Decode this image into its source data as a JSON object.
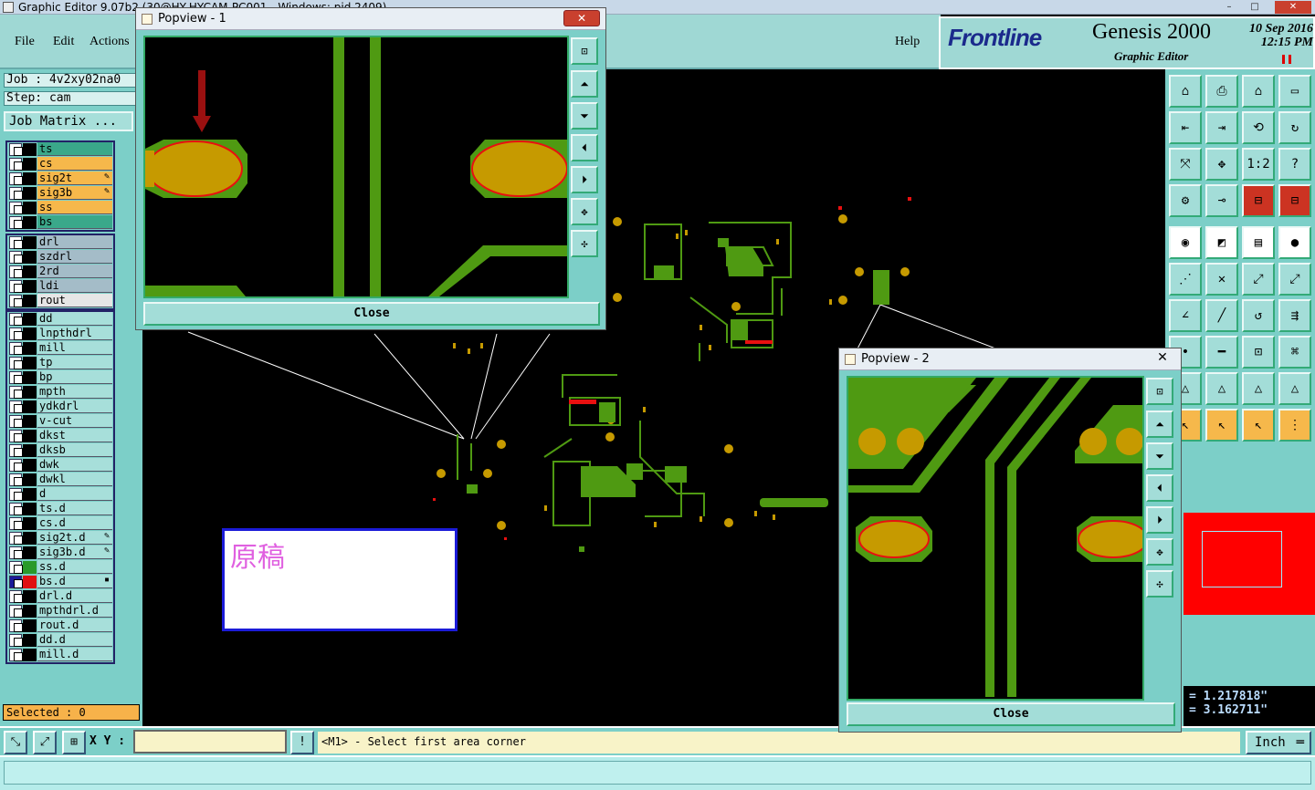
{
  "window": {
    "title": "Graphic Editor 9.07b2 (30@HY-HYCAM-PC001 - Windows: pid 2409)",
    "min": "–",
    "max": "□",
    "close": "✕"
  },
  "menu": {
    "file": "File",
    "edit": "Edit",
    "actions": "Actions",
    "help": "Help"
  },
  "brand": {
    "logo": "Frontline",
    "product": "Genesis 2000",
    "subtitle": "Graphic Editor",
    "date": "10 Sep 2016",
    "time": "12:15 PM"
  },
  "job": {
    "job_label": "Job : 4v2xy02na0",
    "step_label": "Step: cam",
    "matrix_button": "Job Matrix ..."
  },
  "layer_groups": [
    {
      "layers": [
        {
          "name": "ts",
          "color": "#3aa88a",
          "mark": ""
        },
        {
          "name": "cs",
          "color": "#f6b84b",
          "mark": ""
        },
        {
          "name": "sig2t",
          "color": "#f6b84b",
          "mark": "✎"
        },
        {
          "name": "sig3b",
          "color": "#f6b84b",
          "mark": "✎"
        },
        {
          "name": "ss",
          "color": "#f6b84b",
          "mark": ""
        },
        {
          "name": "bs",
          "color": "#3aa88a",
          "mark": ""
        }
      ]
    },
    {
      "layers": [
        {
          "name": "drl",
          "color": "#a4bcc8",
          "mark": ""
        },
        {
          "name": "szdrl",
          "color": "#a4bcc8",
          "mark": ""
        },
        {
          "name": "2rd",
          "color": "#a4bcc8",
          "mark": ""
        },
        {
          "name": "ldi",
          "color": "#a4bcc8",
          "mark": ""
        },
        {
          "name": "rout",
          "color": "#e6e6e6",
          "mark": ""
        }
      ]
    },
    {
      "layers": [
        {
          "name": "dd",
          "color": "#a7dfda",
          "mark": ""
        },
        {
          "name": "lnpthdrl",
          "color": "#a7dfda",
          "mark": ""
        },
        {
          "name": "mill",
          "color": "#a7dfda",
          "mark": ""
        },
        {
          "name": "tp",
          "color": "#a7dfda",
          "mark": ""
        },
        {
          "name": "bp",
          "color": "#a7dfda",
          "mark": ""
        },
        {
          "name": "mpth",
          "color": "#a7dfda",
          "mark": ""
        },
        {
          "name": "ydkdrl",
          "color": "#a7dfda",
          "mark": ""
        },
        {
          "name": "v-cut",
          "color": "#a7dfda",
          "mark": ""
        },
        {
          "name": "dkst",
          "color": "#a7dfda",
          "mark": ""
        },
        {
          "name": "dksb",
          "color": "#a7dfda",
          "mark": ""
        },
        {
          "name": "dwk",
          "color": "#a7dfda",
          "mark": ""
        },
        {
          "name": "dwkl",
          "color": "#a7dfda",
          "mark": ""
        },
        {
          "name": "d",
          "color": "#a7dfda",
          "mark": ""
        },
        {
          "name": "ts.d",
          "color": "#a7dfda",
          "mark": ""
        },
        {
          "name": "cs.d",
          "color": "#a7dfda",
          "mark": ""
        },
        {
          "name": "sig2t.d",
          "color": "#a7dfda",
          "mark": "✎"
        },
        {
          "name": "sig3b.d",
          "color": "#a7dfda",
          "mark": "✎"
        },
        {
          "name": "ss.d",
          "color": "#a7dfda",
          "mark": "",
          "swatch": "#2a9a2a"
        },
        {
          "name": "bs.d",
          "color": "#a7dfda",
          "mark": "▪",
          "swatch": "#e01010",
          "active": true
        },
        {
          "name": "drl.d",
          "color": "#a7dfda",
          "mark": ""
        },
        {
          "name": "mpthdrl.d",
          "color": "#a7dfda",
          "mark": ""
        },
        {
          "name": "rout.d",
          "color": "#a7dfda",
          "mark": ""
        },
        {
          "name": "dd.d",
          "color": "#a7dfda",
          "mark": ""
        },
        {
          "name": "mill.d",
          "color": "#a7dfda",
          "mark": ""
        }
      ]
    }
  ],
  "selected": "Selected : 0",
  "status": {
    "xy_label": "X Y :",
    "xy_value": "",
    "warn": "!",
    "message": "<M1> - Select first area corner",
    "units": "Inch"
  },
  "coords": {
    "x": "= 1.217818\"",
    "y": "= 3.162711\""
  },
  "popview1": {
    "title": "Popview - 1",
    "close": "Close"
  },
  "popview2": {
    "title": "Popview - 2",
    "close": "Close"
  },
  "note": {
    "text": "原稿"
  },
  "toolbar_icons": [
    "zoom-home-icon",
    "zoom-in-icon",
    "home-icon",
    "window-icon",
    "pan-left-icon",
    "pan-right-icon",
    "undo-icon",
    "redraw-icon",
    "fit-icon",
    "center-icon",
    "scale-icon",
    "help-icon",
    "snap-icon",
    "key-icon",
    "layers-icon",
    "layers-red-icon",
    "feature-icon",
    "measure-icon",
    "ruler-icon",
    "dot-icon",
    "connect-icon",
    "cross-icon",
    "point-icon",
    "point2-icon",
    "angle-icon",
    "line-icon",
    "arc-icon",
    "split-icon",
    "pad-icon",
    "minus-icon",
    "size-icon",
    "group-icon",
    "triangle-icon",
    "triangle2-icon",
    "triangle3-icon",
    "triangle4-icon",
    "pointer-icon",
    "pointer2-icon",
    "pointer3-icon",
    "pointer4-icon"
  ],
  "colors": {
    "panel": "#7ccfc8",
    "copper": "#4f9a12",
    "pad": "#c69a00",
    "pad_edge": "#e81010"
  }
}
